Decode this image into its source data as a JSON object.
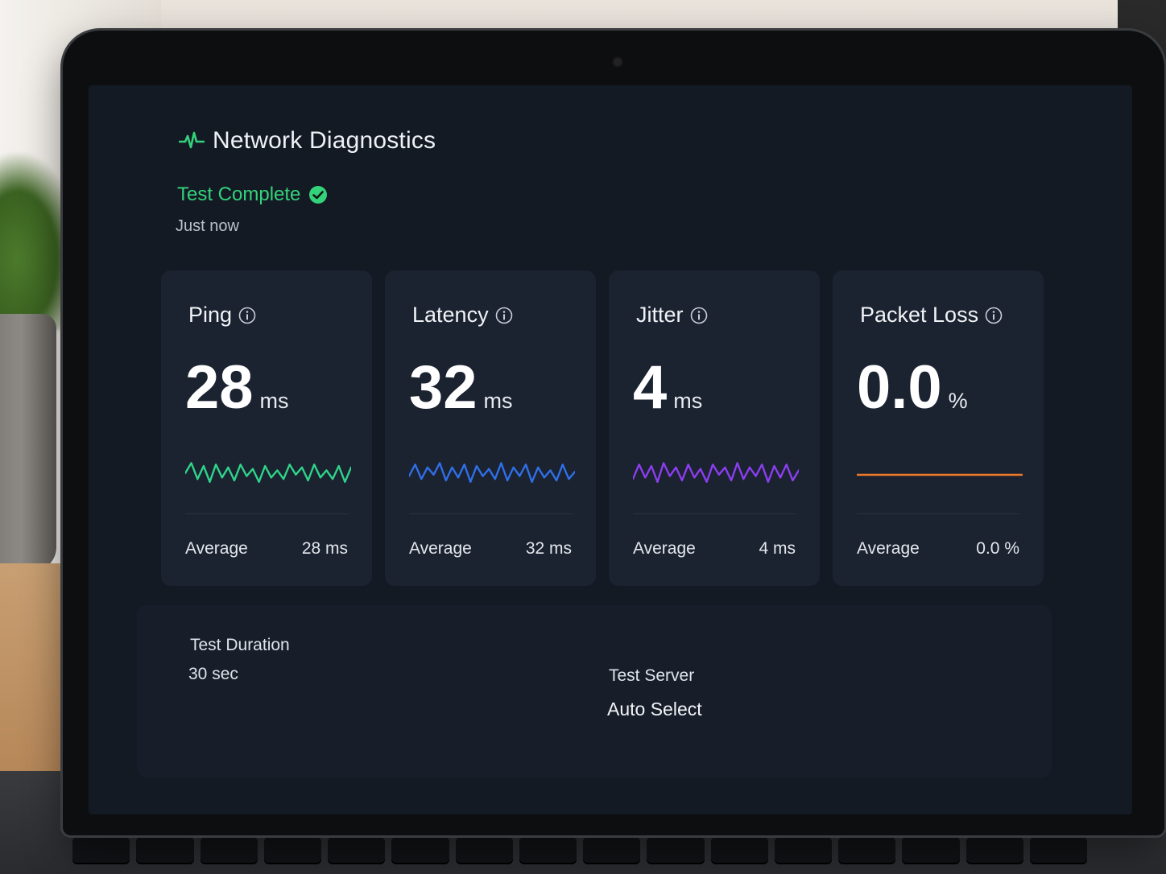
{
  "app": {
    "title": "Network Diagnostics",
    "accent_color": "#34d27b",
    "icon": "pulse-icon"
  },
  "status": {
    "text": "Test Complete",
    "icon": "check-circle-icon",
    "timestamp": "Just now"
  },
  "metrics": [
    {
      "name": "Ping",
      "value": "28",
      "unit": "ms",
      "average_label": "Average",
      "average_value": "28 ms",
      "color": "#2fd48a",
      "trend": [
        0.5,
        0.85,
        0.3,
        0.75,
        0.2,
        0.8,
        0.35,
        0.7,
        0.25,
        0.8,
        0.4,
        0.65,
        0.2,
        0.75,
        0.35,
        0.6,
        0.3,
        0.8,
        0.45,
        0.7,
        0.25,
        0.8,
        0.35,
        0.6,
        0.3,
        0.75,
        0.2,
        0.7
      ]
    },
    {
      "name": "Latency",
      "value": "32",
      "unit": "ms",
      "average_label": "Average",
      "average_value": "32 ms",
      "color": "#2f6fe8",
      "trend": [
        0.4,
        0.8,
        0.3,
        0.7,
        0.45,
        0.85,
        0.25,
        0.7,
        0.35,
        0.8,
        0.2,
        0.75,
        0.4,
        0.65,
        0.3,
        0.85,
        0.25,
        0.7,
        0.4,
        0.8,
        0.2,
        0.7,
        0.35,
        0.6,
        0.25,
        0.8,
        0.3,
        0.55
      ]
    },
    {
      "name": "Jitter",
      "value": "4",
      "unit": "ms",
      "average_label": "Average",
      "average_value": "4 ms",
      "color": "#8b3ef0",
      "trend": [
        0.3,
        0.8,
        0.35,
        0.75,
        0.2,
        0.85,
        0.4,
        0.7,
        0.25,
        0.8,
        0.35,
        0.65,
        0.2,
        0.8,
        0.45,
        0.7,
        0.25,
        0.85,
        0.3,
        0.7,
        0.4,
        0.8,
        0.2,
        0.75,
        0.35,
        0.8,
        0.25,
        0.6
      ]
    },
    {
      "name": "Packet Loss",
      "value": "0.0",
      "unit": "%",
      "average_label": "Average",
      "average_value": "0.0 %",
      "color": "#f07a2a",
      "trend": [
        0,
        0,
        0,
        0,
        0,
        0,
        0,
        0,
        0,
        0,
        0,
        0,
        0,
        0,
        0,
        0,
        0,
        0,
        0,
        0,
        0,
        0,
        0,
        0,
        0,
        0,
        0,
        0
      ]
    }
  ],
  "test_info": {
    "duration_label": "Test Duration",
    "duration_value": "30 sec",
    "server_label": "Test Server",
    "server_value": "Auto Select"
  }
}
